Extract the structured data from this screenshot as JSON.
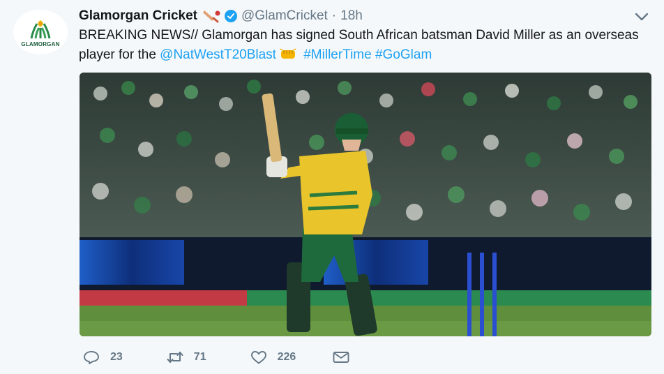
{
  "tweet": {
    "author": {
      "display_name": "Glamorgan Cricket",
      "handle": "@GlamCricket",
      "verified": true,
      "avatar_label": "GLAMORGAN"
    },
    "separator": "·",
    "time": "18h",
    "text": {
      "part1": "BREAKING NEWS// Glamorgan has signed South African batsman David Miller as an overseas player for the ",
      "mention": "@NatWestT20Blast",
      "hashtag1": "#MillerTime",
      "hashtag2": "#GoGlam"
    },
    "media_label": "",
    "actions": {
      "replies": "23",
      "retweets": "71",
      "likes": "226"
    }
  },
  "colors": {
    "link": "#1da1f2",
    "muted": "#657786",
    "background": "#f5f8fa"
  },
  "icons": [
    "cricket-bat-emoji",
    "verified-badge",
    "chevron-down",
    "fist-bump-emoji",
    "reply",
    "retweet",
    "like",
    "direct-message"
  ]
}
